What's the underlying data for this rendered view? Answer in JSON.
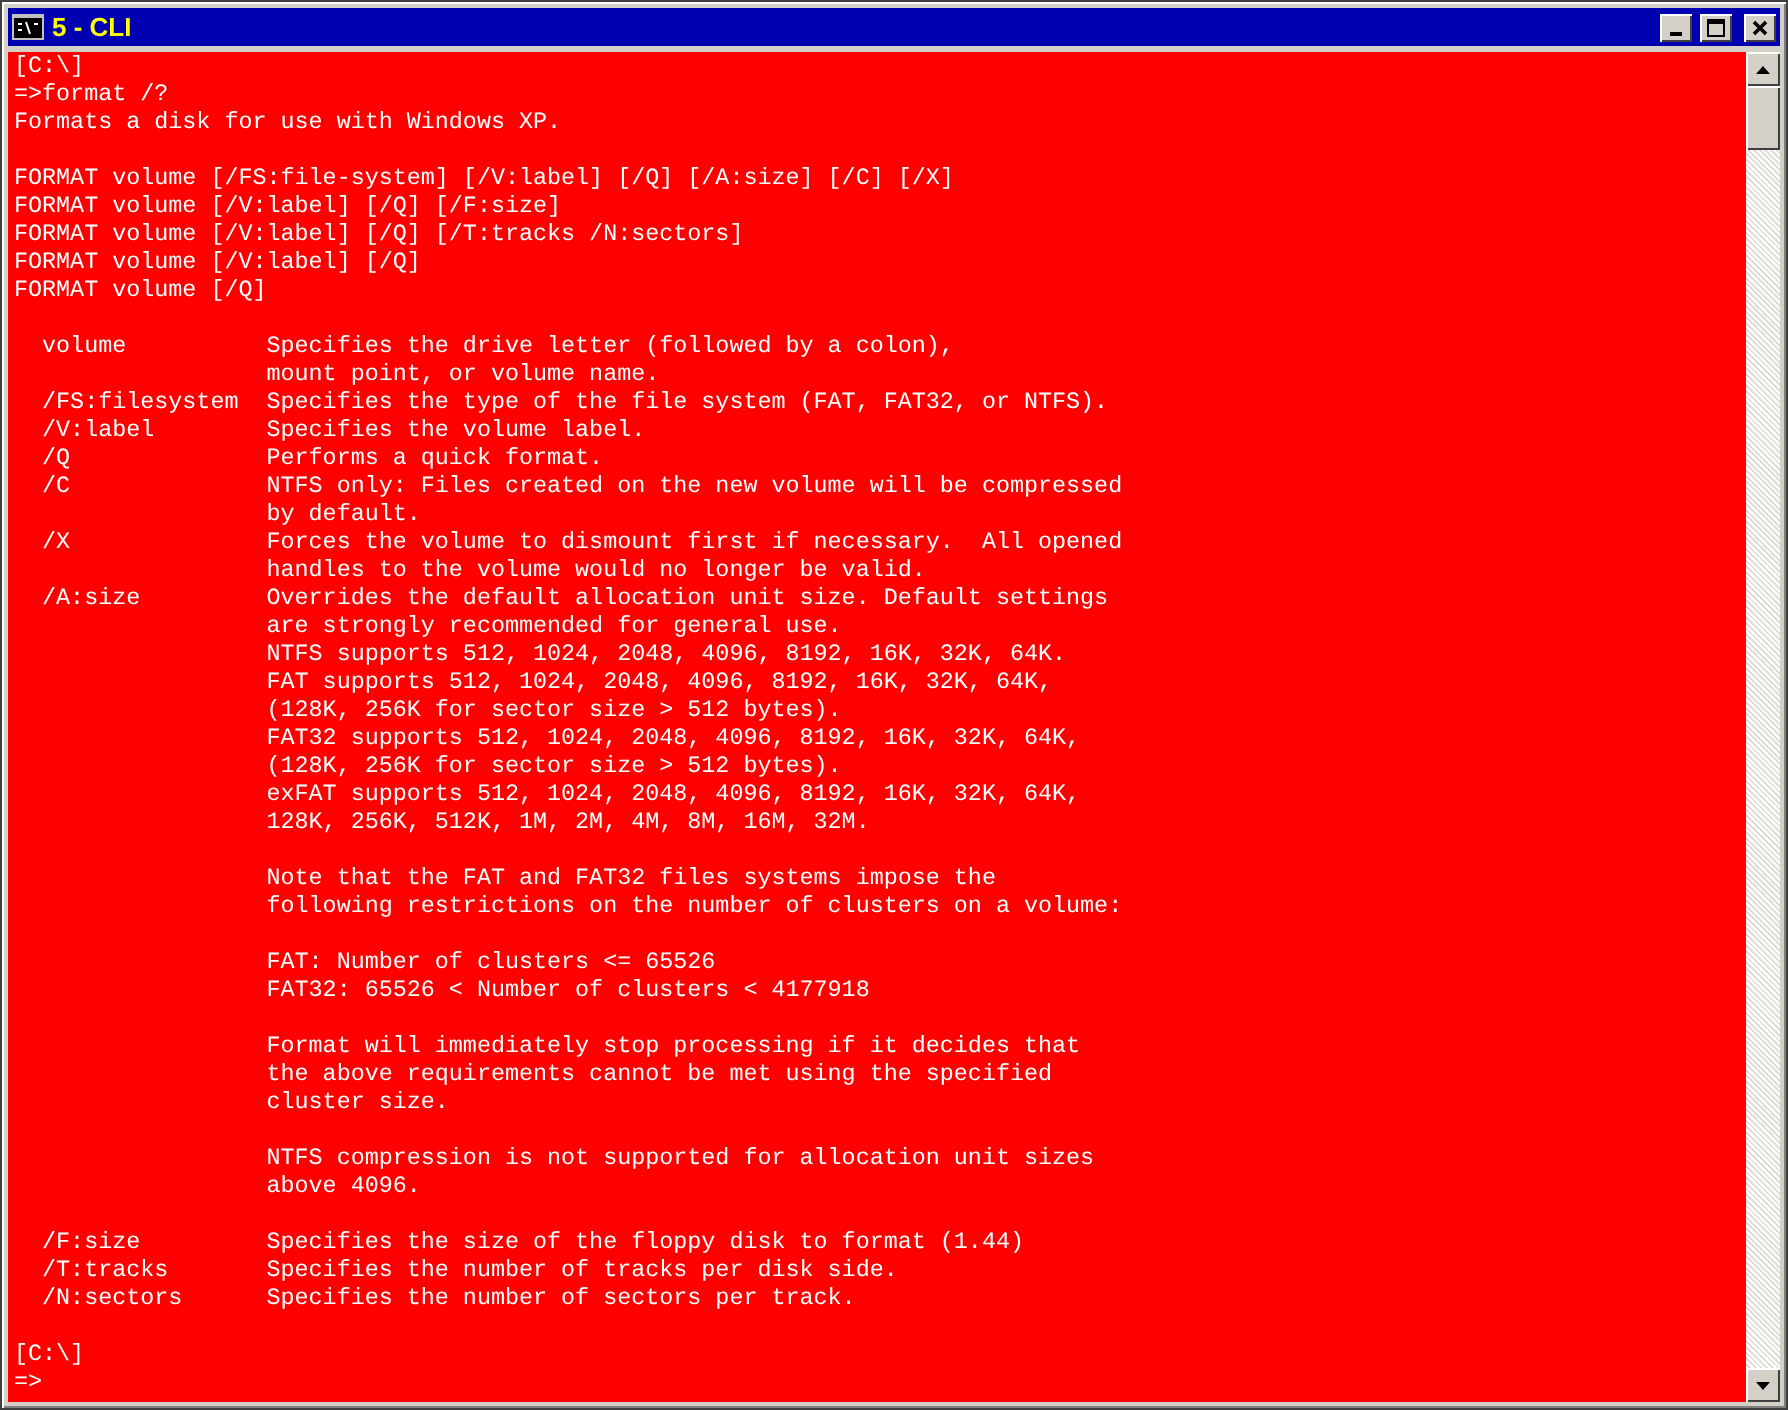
{
  "window": {
    "title": "5 - CLI"
  },
  "console": {
    "blocks": [
      [
        "[C:\\]",
        "=>format /?",
        "Formats a disk for use with Windows XP."
      ],
      [
        "FORMAT volume [/FS:file-system] [/V:label] [/Q] [/A:size] [/C] [/X]",
        "FORMAT volume [/V:label] [/Q] [/F:size]",
        "FORMAT volume [/V:label] [/Q] [/T:tracks /N:sectors]",
        "FORMAT volume [/V:label] [/Q]",
        "FORMAT volume [/Q]"
      ],
      [
        "  volume          Specifies the drive letter (followed by a colon),",
        "                  mount point, or volume name.",
        "  /FS:filesystem  Specifies the type of the file system (FAT, FAT32, or NTFS).",
        "  /V:label        Specifies the volume label.",
        "  /Q              Performs a quick format.",
        "  /C              NTFS only: Files created on the new volume will be compressed",
        "                  by default.",
        "  /X              Forces the volume to dismount first if necessary.  All opened",
        "                  handles to the volume would no longer be valid.",
        "  /A:size         Overrides the default allocation unit size. Default settings",
        "                  are strongly recommended for general use.",
        "                  NTFS supports 512, 1024, 2048, 4096, 8192, 16K, 32K, 64K.",
        "                  FAT supports 512, 1024, 2048, 4096, 8192, 16K, 32K, 64K,",
        "                  (128K, 256K for sector size > 512 bytes).",
        "                  FAT32 supports 512, 1024, 2048, 4096, 8192, 16K, 32K, 64K,",
        "                  (128K, 256K for sector size > 512 bytes).",
        "                  exFAT supports 512, 1024, 2048, 4096, 8192, 16K, 32K, 64K,",
        "                  128K, 256K, 512K, 1M, 2M, 4M, 8M, 16M, 32M."
      ],
      [
        "                  Note that the FAT and FAT32 files systems impose the",
        "                  following restrictions on the number of clusters on a volume:"
      ],
      [
        "                  FAT: Number of clusters <= 65526",
        "                  FAT32: 65526 < Number of clusters < 4177918"
      ],
      [
        "                  Format will immediately stop processing if it decides that",
        "                  the above requirements cannot be met using the specified",
        "                  cluster size."
      ],
      [
        "                  NTFS compression is not supported for allocation unit sizes",
        "                  above 4096."
      ],
      [
        "  /F:size         Specifies the size of the floppy disk to format (1.44)",
        "  /T:tracks       Specifies the number of tracks per disk side.",
        "  /N:sectors      Specifies the number of sectors per track."
      ],
      [
        "[C:\\]",
        "=>"
      ]
    ]
  }
}
